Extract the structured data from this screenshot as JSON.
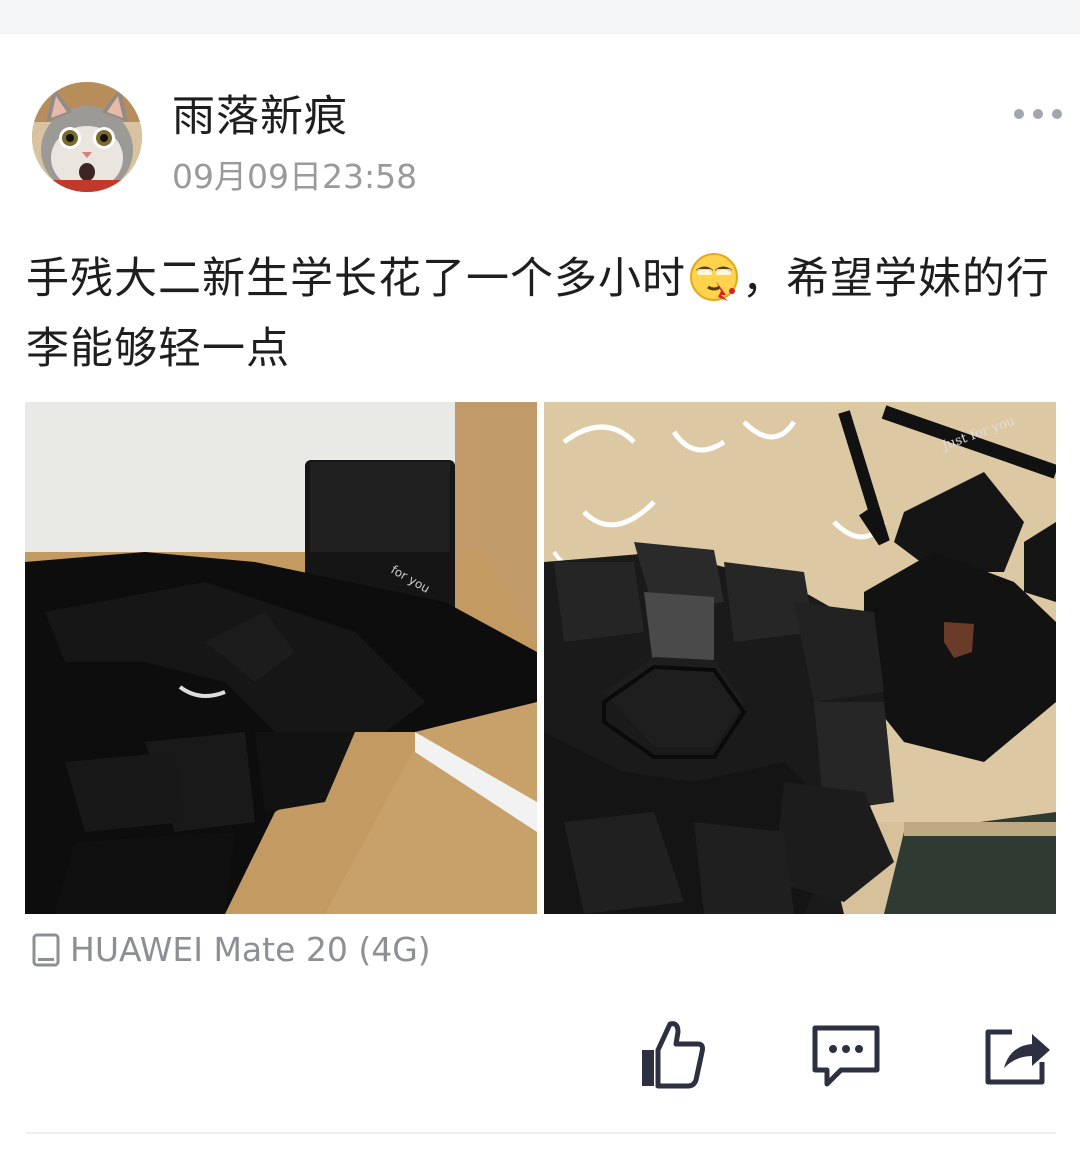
{
  "post": {
    "author_name": "雨落新痕",
    "timestamp": "09月09日23:58",
    "text_before_emoji": "手残大二新生学长花了一个多小时",
    "text_after_emoji": "，希望学妹的行李能够轻一点",
    "emoji_icon": "nosebleed-emoji-icon",
    "device": "HUAWEI Mate 20 (4G)",
    "photos": [
      {
        "description_icon": "photo-black-boxes-on-desk"
      },
      {
        "description_icon": "photo-black-hexagon-explosion-box"
      }
    ]
  },
  "actions": {
    "more_icon": "more-dots-icon",
    "like_icon": "thumbs-up-icon",
    "comment_icon": "comment-icon",
    "share_icon": "share-icon"
  },
  "colors": {
    "text": "#1e1e1e",
    "muted": "#9a9a9a",
    "icon": "#2d3040",
    "background": "#ffffff"
  }
}
